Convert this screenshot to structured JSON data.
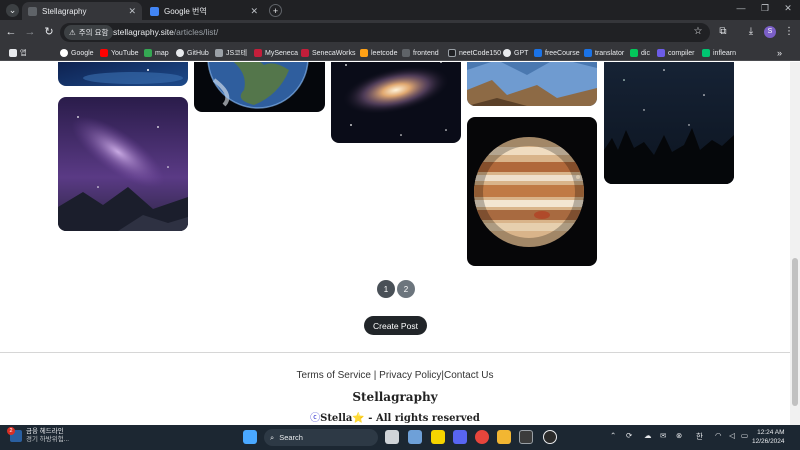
{
  "browser": {
    "tabs": [
      {
        "title": "Stellagraphy",
        "active": true
      },
      {
        "title": "Google 번역",
        "active": false
      }
    ],
    "address": {
      "warning_chip": "주의 요함",
      "domain": "stellagraphy.site",
      "path": "/articles/list/"
    },
    "bookmarks": [
      {
        "label": "앱"
      },
      {
        "label": "Google"
      },
      {
        "label": "YouTube"
      },
      {
        "label": "map"
      },
      {
        "label": "GitHub"
      },
      {
        "label": "JS코테"
      },
      {
        "label": "MySeneca"
      },
      {
        "label": "SenecaWorks"
      },
      {
        "label": "leetcode"
      },
      {
        "label": "frontend"
      },
      {
        "label": "neetCode150"
      },
      {
        "label": "GPT"
      },
      {
        "label": "freeCourse"
      },
      {
        "label": "translator"
      },
      {
        "label": "dic"
      },
      {
        "label": "compiler"
      },
      {
        "label": "inflearn"
      }
    ],
    "profile_initial": "S"
  },
  "page": {
    "pagination": [
      "1",
      "2"
    ],
    "current_page": "1",
    "create_post_label": "Create Post",
    "footer": {
      "terms": "Terms of Service",
      "privacy": "Privacy Policy",
      "contact": "Contact Us",
      "separator": "|",
      "brand": "Stellagraphy",
      "copyright_mark": "ⓒ",
      "copyright_text": "Stella⭐ - All rights reserved"
    }
  },
  "taskbar": {
    "widget_title": "금융 헤드라인",
    "widget_subtitle": "경기 하방위험...",
    "widget_badge": "2",
    "search_label": "Search",
    "ime_label": "한",
    "time": "12:24 AM",
    "date": "12/26/2024"
  },
  "colors": {
    "chrome_dark": "#202124",
    "chrome_toolbar": "#35363a",
    "button_dark": "#212529",
    "pagination_gray": "#6c757d",
    "taskbar": "#1c2732"
  }
}
